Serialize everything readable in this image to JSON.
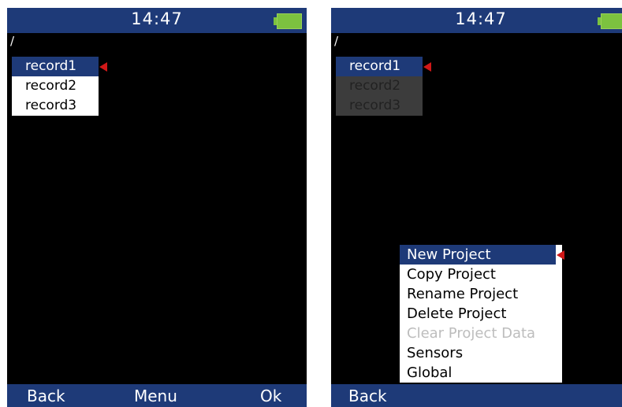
{
  "left_screen": {
    "time": "14:47",
    "path": "/",
    "records": [
      "record1",
      "record2",
      "record3"
    ],
    "softkeys": {
      "left": "Back",
      "center": "Menu",
      "right": "Ok"
    }
  },
  "right_screen": {
    "time": "14:47",
    "path": "/",
    "records": [
      "record1",
      "record2",
      "record3"
    ],
    "menu": {
      "items": [
        {
          "label": "New Project",
          "state": "selected"
        },
        {
          "label": "Copy Project",
          "state": "enabled"
        },
        {
          "label": "Rename Project",
          "state": "enabled"
        },
        {
          "label": "Delete Project",
          "state": "enabled"
        },
        {
          "label": "Clear Project Data",
          "state": "disabled"
        },
        {
          "label": "Sensors",
          "state": "enabled"
        },
        {
          "label": "Global",
          "state": "enabled"
        }
      ]
    },
    "softkeys": {
      "left": "Back"
    }
  },
  "colors": {
    "bar": "#1e3a78",
    "screen_bg": "#000000",
    "selection": "#1e3a78",
    "marker": "#d01818",
    "battery": "#7cc23f",
    "disabled_text": "#bdbdbd"
  },
  "icons": {
    "battery": "battery-full-icon",
    "marker": "selection-marker-icon"
  }
}
